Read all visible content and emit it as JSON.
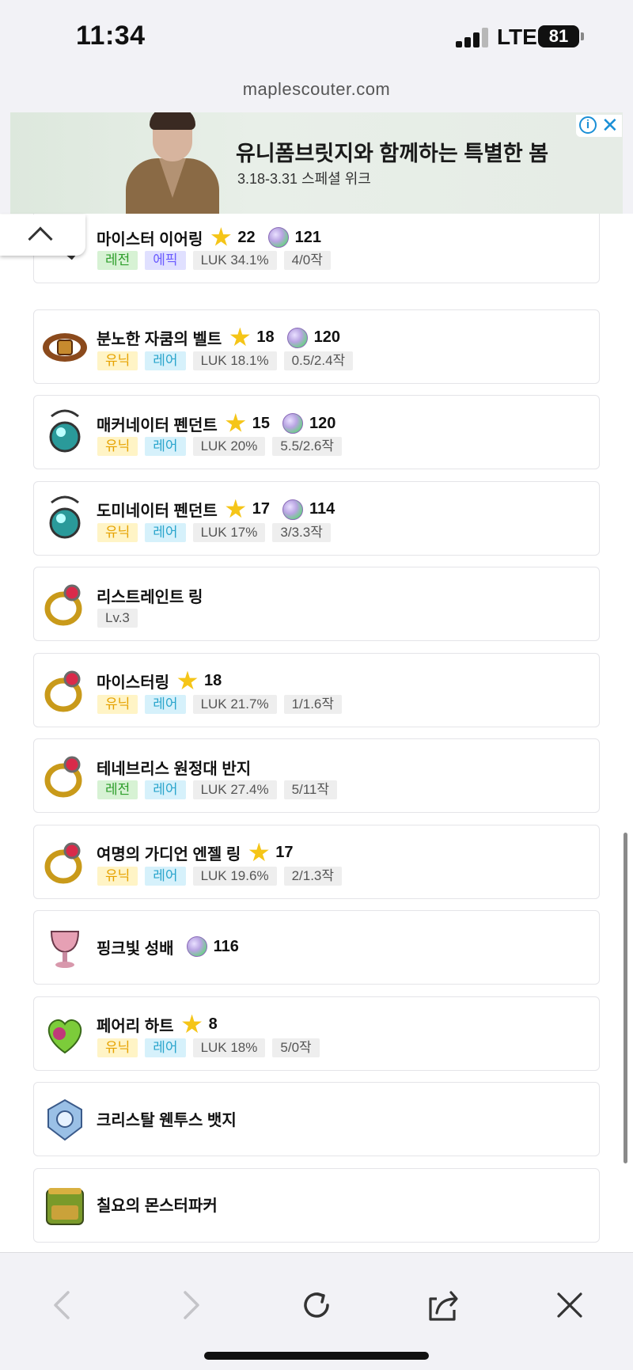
{
  "status_bar": {
    "time": "11:34",
    "network": "LTE",
    "battery": "81"
  },
  "browser": {
    "url": "maplescouter.com"
  },
  "ad": {
    "headline": "유니폼브릿지와 함께하는 특별한 봄",
    "subtext": "3.18-3.31 스페셜 위크",
    "info_label": "i",
    "close_label": "✕"
  },
  "items": [
    {
      "name": "마이스터 이어링",
      "stars": "22",
      "gem": "121",
      "tags": [
        {
          "text": "레전",
          "kind": "legendary"
        },
        {
          "text": "에픽",
          "kind": "epic"
        },
        {
          "text": "LUK 34.1%",
          "kind": "gray"
        },
        {
          "text": "4/0작",
          "kind": "gray"
        }
      ],
      "icon": "earring-icon"
    },
    {
      "name": "분노한 자쿰의 벨트",
      "stars": "18",
      "gem": "120",
      "tags": [
        {
          "text": "유닉",
          "kind": "unique"
        },
        {
          "text": "레어",
          "kind": "rare"
        },
        {
          "text": "LUK 18.1%",
          "kind": "gray"
        },
        {
          "text": "0.5/2.4작",
          "kind": "gray"
        }
      ],
      "icon": "belt-icon"
    },
    {
      "name": "매커네이터 펜던트",
      "stars": "15",
      "gem": "120",
      "tags": [
        {
          "text": "유닉",
          "kind": "unique"
        },
        {
          "text": "레어",
          "kind": "rare"
        },
        {
          "text": "LUK 20%",
          "kind": "gray"
        },
        {
          "text": "5.5/2.6작",
          "kind": "gray"
        }
      ],
      "icon": "pendant-icon"
    },
    {
      "name": "도미네이터 펜던트",
      "stars": "17",
      "gem": "114",
      "tags": [
        {
          "text": "유닉",
          "kind": "unique"
        },
        {
          "text": "레어",
          "kind": "rare"
        },
        {
          "text": "LUK 17%",
          "kind": "gray"
        },
        {
          "text": "3/3.3작",
          "kind": "gray"
        }
      ],
      "icon": "pendant-icon"
    },
    {
      "name": "리스트레인트 링",
      "stars": null,
      "gem": null,
      "tags": [
        {
          "text": "Lv.3",
          "kind": "gray"
        }
      ],
      "icon": "ring-icon"
    },
    {
      "name": "마이스터링",
      "stars": "18",
      "gem": null,
      "tags": [
        {
          "text": "유닉",
          "kind": "unique"
        },
        {
          "text": "레어",
          "kind": "rare"
        },
        {
          "text": "LUK 21.7%",
          "kind": "gray"
        },
        {
          "text": "1/1.6작",
          "kind": "gray"
        }
      ],
      "icon": "ring-icon"
    },
    {
      "name": "테네브리스 원정대 반지",
      "stars": null,
      "gem": null,
      "tags": [
        {
          "text": "레전",
          "kind": "legendary"
        },
        {
          "text": "레어",
          "kind": "rare"
        },
        {
          "text": "LUK 27.4%",
          "kind": "gray"
        },
        {
          "text": "5/11작",
          "kind": "gray"
        }
      ],
      "icon": "ring-icon"
    },
    {
      "name": "여명의 가디언 엔젤 링",
      "stars": "17",
      "gem": null,
      "tags": [
        {
          "text": "유닉",
          "kind": "unique"
        },
        {
          "text": "레어",
          "kind": "rare"
        },
        {
          "text": "LUK 19.6%",
          "kind": "gray"
        },
        {
          "text": "2/1.3작",
          "kind": "gray"
        }
      ],
      "icon": "ring-icon"
    },
    {
      "name": "핑크빛 성배",
      "stars": null,
      "gem": "116",
      "tags": [],
      "icon": "chalice-icon"
    },
    {
      "name": "페어리 하트",
      "stars": "8",
      "gem": null,
      "tags": [
        {
          "text": "유닉",
          "kind": "unique"
        },
        {
          "text": "레어",
          "kind": "rare"
        },
        {
          "text": "LUK 18%",
          "kind": "gray"
        },
        {
          "text": "5/0작",
          "kind": "gray"
        }
      ],
      "icon": "heart-icon"
    },
    {
      "name": "크리스탈 웬투스 뱃지",
      "stars": null,
      "gem": null,
      "tags": [],
      "icon": "badge-icon"
    },
    {
      "name": "칠요의 몬스터파커",
      "stars": null,
      "gem": null,
      "tags": [],
      "icon": "pocket-icon"
    }
  ],
  "toolbar": {
    "back": "back-icon",
    "forward": "forward-icon",
    "reload": "reload-icon",
    "share": "share-icon",
    "close": "close-icon"
  }
}
